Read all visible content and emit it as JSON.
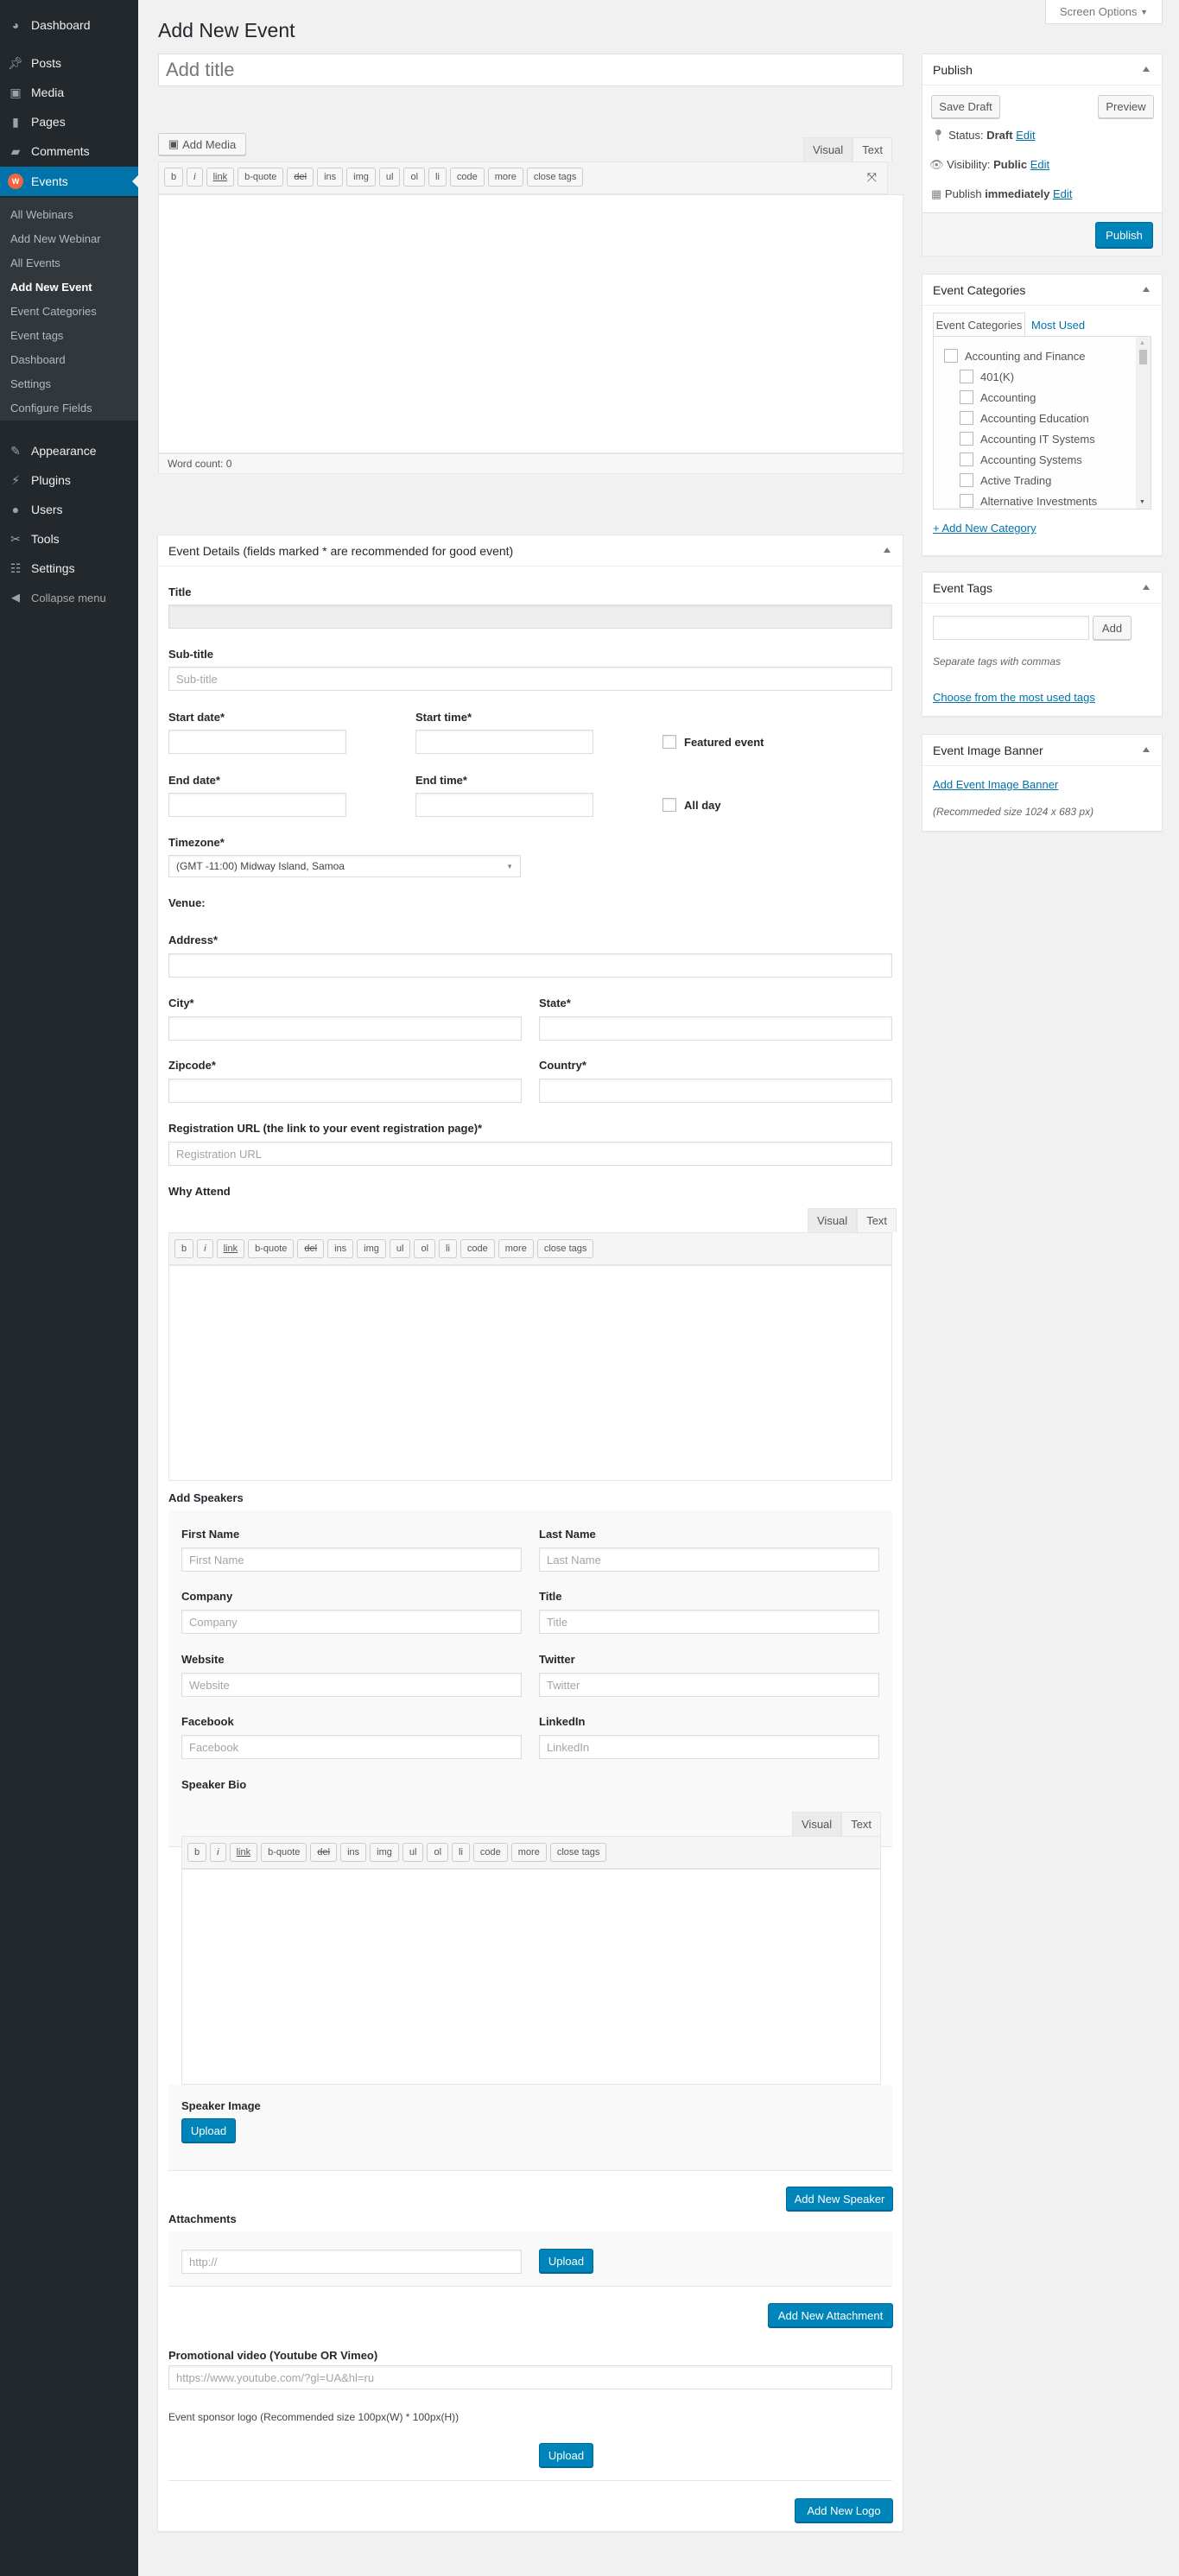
{
  "sidebar": {
    "items": [
      {
        "label": "Dashboard",
        "icon": "dashboard-icon"
      },
      {
        "label": "Posts",
        "icon": "pin-icon"
      },
      {
        "label": "Media",
        "icon": "media-icon"
      },
      {
        "label": "Pages",
        "icon": "pages-icon"
      },
      {
        "label": "Comments",
        "icon": "comment-icon"
      },
      {
        "label": "Events",
        "icon": "events-icon",
        "active": true
      },
      {
        "label": "Appearance",
        "icon": "brush-icon"
      },
      {
        "label": "Plugins",
        "icon": "plug-icon"
      },
      {
        "label": "Users",
        "icon": "user-icon"
      },
      {
        "label": "Tools",
        "icon": "wrench-icon"
      },
      {
        "label": "Settings",
        "icon": "settings-icon"
      }
    ],
    "submenu": [
      "All Webinars",
      "Add New Webinar",
      "All Events",
      "Add New Event",
      "Event Categories",
      "Event tags",
      "Dashboard",
      "Settings",
      "Configure Fields"
    ],
    "current_sub": "Add New Event",
    "collapse": "Collapse menu"
  },
  "header": {
    "title": "Add New Event",
    "screen_options": "Screen Options"
  },
  "post": {
    "title_placeholder": "Add title",
    "add_media": "Add Media",
    "tab_visual": "Visual",
    "tab_text": "Text",
    "quicktags": [
      "b",
      "i",
      "link",
      "b-quote",
      "del",
      "ins",
      "img",
      "ul",
      "ol",
      "li",
      "code",
      "more",
      "close tags"
    ],
    "word_count": "Word count: 0"
  },
  "publish": {
    "title": "Publish",
    "save_draft": "Save Draft",
    "preview": "Preview",
    "status_label": "Status:",
    "status_value": "Draft",
    "visibility_label": "Visibility:",
    "visibility_value": "Public",
    "publish_label": "Publish",
    "publish_value": "immediately",
    "edit": "Edit",
    "publish_button": "Publish"
  },
  "categories": {
    "title": "Event Categories",
    "tab_all": "Event Categories",
    "tab_most_used": "Most Used",
    "parent": "Accounting and Finance",
    "children": [
      "401(K)",
      "Accounting",
      "Accounting Education",
      "Accounting IT Systems",
      "Accounting Systems",
      "Active Trading",
      "Alternative Investments"
    ],
    "add_new": "+ Add New Category"
  },
  "tags": {
    "title": "Event Tags",
    "add": "Add",
    "hint": "Separate tags with commas",
    "choose": "Choose from the most used tags"
  },
  "banner": {
    "title": "Event Image Banner",
    "link": "Add Event Image Banner",
    "hint": "(Recommeded size 1024 x 683 px)"
  },
  "details": {
    "header": "Event Details (fields marked * are recommended for good event)",
    "title_label": "Title",
    "subtitle_label": "Sub-title",
    "subtitle_placeholder": "Sub-title",
    "start_date": "Start date*",
    "start_time": "Start time*",
    "featured": "Featured event",
    "end_date": "End date*",
    "end_time": "End time*",
    "all_day": "All day",
    "timezone_label": "Timezone*",
    "timezone_value": "(GMT -11:00) Midway Island, Samoa",
    "venue": "Venue:",
    "address": "Address*",
    "city": "City*",
    "state": "State*",
    "zipcode": "Zipcode*",
    "country": "Country*",
    "reg_label": "Registration URL (the link to your event registration page)*",
    "reg_placeholder": "Registration URL",
    "why_attend": "Why Attend",
    "speakers_label": "Add Speakers",
    "first_name": "First Name",
    "last_name": "Last Name",
    "company": "Company",
    "sp_title": "Title",
    "website": "Website",
    "twitter": "Twitter",
    "facebook": "Facebook",
    "linkedin": "LinkedIn",
    "speaker_bio": "Speaker Bio",
    "speaker_image": "Speaker Image",
    "upload": "Upload",
    "add_speaker": "Add New Speaker",
    "attachments": "Attachments",
    "attach_placeholder": "http://",
    "add_attachment": "Add New Attachment",
    "promo_label": "Promotional video (Youtube OR Vimeo)",
    "promo_placeholder": "https://www.youtube.com/?gl=UA&hl=ru",
    "sponsor_label": "Event sponsor logo (Recommended size 100px(W) * 100px(H))",
    "add_logo": "Add New Logo"
  }
}
